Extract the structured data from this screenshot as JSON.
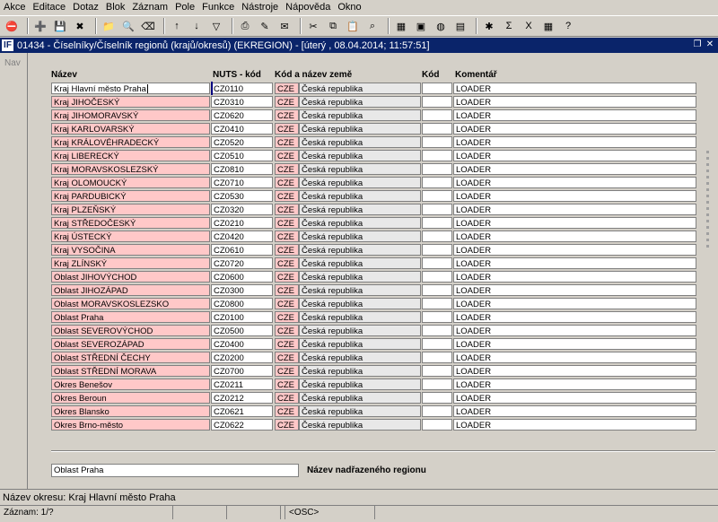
{
  "menu": [
    "Akce",
    "Editace",
    "Dotaz",
    "Blok",
    "Záznam",
    "Pole",
    "Funkce",
    "Nástroje",
    "Nápověda",
    "Okno"
  ],
  "toolbar_icons": [
    "exit-icon",
    "insert-record-icon",
    "save-icon",
    "delete-record-icon",
    "folder-icon",
    "query-icon",
    "clear-icon",
    "sort-asc-icon",
    "sort-desc-icon",
    "filter-icon",
    "print-icon",
    "edit-icon",
    "mail-icon",
    "cut-icon",
    "copy-icon",
    "paste-icon",
    "zoom-icon",
    "calculator-icon",
    "image-icon",
    "globe-icon",
    "calendar-icon",
    "settings-icon",
    "sigma-icon",
    "excel-icon",
    "grid-icon",
    "help-icon"
  ],
  "window": {
    "title": "01434 - Číselníky/Číselník regionů (krajů/okresů) (EKREGION) - [úterý , 08.04.2014; 11:57:51]",
    "logo": "IF"
  },
  "nav_label": "Nav",
  "headers": {
    "name": "Název",
    "nuts": "NUTS - kód",
    "country": "Kód a název země",
    "code": "Kód",
    "comment": "Komentář"
  },
  "rows": [
    {
      "name": "Kraj Hlavní město Praha",
      "nuts": "CZ0110",
      "cc": "CZE",
      "country": "Česká republika",
      "code": "",
      "comment": "LOADER"
    },
    {
      "name": "Kraj JIHOČESKÝ",
      "nuts": "CZ0310",
      "cc": "CZE",
      "country": "Česká republika",
      "code": "",
      "comment": "LOADER"
    },
    {
      "name": "Kraj JIHOMORAVSKÝ",
      "nuts": "CZ0620",
      "cc": "CZE",
      "country": "Česká republika",
      "code": "",
      "comment": "LOADER"
    },
    {
      "name": "Kraj KARLOVARSKÝ",
      "nuts": "CZ0410",
      "cc": "CZE",
      "country": "Česká republika",
      "code": "",
      "comment": "LOADER"
    },
    {
      "name": "Kraj KRÁLOVÉHRADECKÝ",
      "nuts": "CZ0520",
      "cc": "CZE",
      "country": "Česká republika",
      "code": "",
      "comment": "LOADER"
    },
    {
      "name": "Kraj LIBERECKÝ",
      "nuts": "CZ0510",
      "cc": "CZE",
      "country": "Česká republika",
      "code": "",
      "comment": "LOADER"
    },
    {
      "name": "Kraj MORAVSKOSLEZSKÝ",
      "nuts": "CZ0810",
      "cc": "CZE",
      "country": "Česká republika",
      "code": "",
      "comment": "LOADER"
    },
    {
      "name": "Kraj OLOMOUCKÝ",
      "nuts": "CZ0710",
      "cc": "CZE",
      "country": "Česká republika",
      "code": "",
      "comment": "LOADER"
    },
    {
      "name": "Kraj PARDUBICKÝ",
      "nuts": "CZ0530",
      "cc": "CZE",
      "country": "Česká republika",
      "code": "",
      "comment": "LOADER"
    },
    {
      "name": "Kraj PLZEŇSKÝ",
      "nuts": "CZ0320",
      "cc": "CZE",
      "country": "Česká republika",
      "code": "",
      "comment": "LOADER"
    },
    {
      "name": "Kraj STŘEDOČESKÝ",
      "nuts": "CZ0210",
      "cc": "CZE",
      "country": "Česká republika",
      "code": "",
      "comment": "LOADER"
    },
    {
      "name": "Kraj ÚSTECKÝ",
      "nuts": "CZ0420",
      "cc": "CZE",
      "country": "Česká republika",
      "code": "",
      "comment": "LOADER"
    },
    {
      "name": "Kraj VYSOČINA",
      "nuts": "CZ0610",
      "cc": "CZE",
      "country": "Česká republika",
      "code": "",
      "comment": "LOADER"
    },
    {
      "name": "Kraj ZLÍNSKÝ",
      "nuts": "CZ0720",
      "cc": "CZE",
      "country": "Česká republika",
      "code": "",
      "comment": "LOADER"
    },
    {
      "name": "Oblast JIHOVÝCHOD",
      "nuts": "CZ0600",
      "cc": "CZE",
      "country": "Česká republika",
      "code": "",
      "comment": "LOADER"
    },
    {
      "name": "Oblast JIHOZÁPAD",
      "nuts": "CZ0300",
      "cc": "CZE",
      "country": "Česká republika",
      "code": "",
      "comment": "LOADER"
    },
    {
      "name": "Oblast MORAVSKOSLEZSKO",
      "nuts": "CZ0800",
      "cc": "CZE",
      "country": "Česká republika",
      "code": "",
      "comment": "LOADER"
    },
    {
      "name": "Oblast Praha",
      "nuts": "CZ0100",
      "cc": "CZE",
      "country": "Česká republika",
      "code": "",
      "comment": "LOADER"
    },
    {
      "name": "Oblast SEVEROVÝCHOD",
      "nuts": "CZ0500",
      "cc": "CZE",
      "country": "Česká republika",
      "code": "",
      "comment": "LOADER"
    },
    {
      "name": "Oblast SEVEROZÁPAD",
      "nuts": "CZ0400",
      "cc": "CZE",
      "country": "Česká republika",
      "code": "",
      "comment": "LOADER"
    },
    {
      "name": "Oblast STŘEDNÍ ČECHY",
      "nuts": "CZ0200",
      "cc": "CZE",
      "country": "Česká republika",
      "code": "",
      "comment": "LOADER"
    },
    {
      "name": "Oblast STŘEDNÍ MORAVA",
      "nuts": "CZ0700",
      "cc": "CZE",
      "country": "Česká republika",
      "code": "",
      "comment": "LOADER"
    },
    {
      "name": "Okres Benešov",
      "nuts": "CZ0211",
      "cc": "CZE",
      "country": "Česká republika",
      "code": "",
      "comment": "LOADER"
    },
    {
      "name": "Okres Beroun",
      "nuts": "CZ0212",
      "cc": "CZE",
      "country": "Česká republika",
      "code": "",
      "comment": "LOADER"
    },
    {
      "name": "Okres Blansko",
      "nuts": "CZ0621",
      "cc": "CZE",
      "country": "Česká republika",
      "code": "",
      "comment": "LOADER"
    },
    {
      "name": "Okres Brno-město",
      "nuts": "CZ0622",
      "cc": "CZE",
      "country": "Česká republika",
      "code": "",
      "comment": "LOADER"
    }
  ],
  "parent": {
    "value": "Oblast Praha",
    "label": "Název nadřazeného regionu"
  },
  "status": {
    "line1": "Název okresu: Kraj Hlavní město Praha",
    "record": "Záznam: 1/?",
    "seg2": "",
    "seg3": "",
    "seg4": "",
    "osc": "<OSC>"
  },
  "colors": {
    "required_field": "#ffc8c8",
    "title_bar": "#0a246a",
    "window_bg": "#d4d0c8"
  }
}
